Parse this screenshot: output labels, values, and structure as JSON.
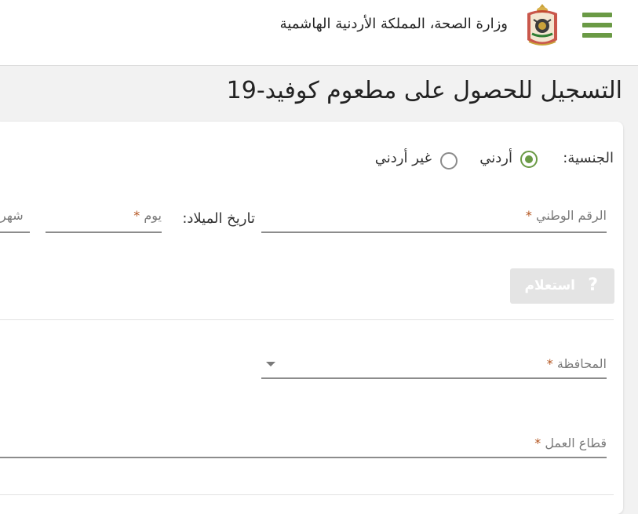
{
  "header": {
    "ministry_title": "وزارة الصحة، المملكة الأردنية الهاشمية",
    "menu_icon": "hamburger-menu-icon",
    "emblem_icon": "jordan-coat-of-arms-icon",
    "accent_color": "#6a9a45"
  },
  "page": {
    "title": "التسجيل للحصول على مطعوم كوفيد-19"
  },
  "form": {
    "nationality": {
      "label": "الجنسية:",
      "options": [
        "أردني",
        "غير أردني"
      ],
      "selected": "أردني"
    },
    "national_id": {
      "placeholder": "الرقم الوطني",
      "required_mark": "*",
      "value": ""
    },
    "birth_date": {
      "label": "تاريخ الميلاد:",
      "day_placeholder": "يوم",
      "month_placeholder": "شهر",
      "required_mark": "*"
    },
    "inquiry_button": {
      "label": "استعلام",
      "icon": "question-mark-icon",
      "disabled": true
    },
    "governorate": {
      "placeholder": "المحافظة",
      "required_mark": "*",
      "selected": ""
    },
    "work_sector": {
      "placeholder": "قطاع العمل",
      "required_mark": "*",
      "value": ""
    }
  }
}
